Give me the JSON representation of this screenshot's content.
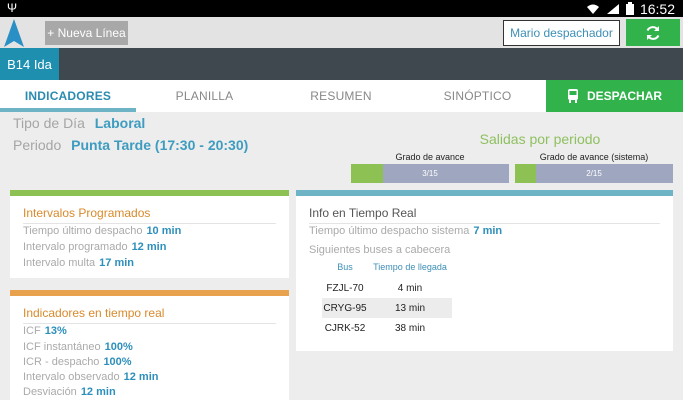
{
  "statusbar": {
    "time": "16:52"
  },
  "appbar": {
    "new_line_label": "+ Nueva Línea",
    "user_label": "Mario despachador"
  },
  "route": {
    "name": "B14 Ida"
  },
  "tabs": [
    {
      "label": "INDICADORES",
      "active": true
    },
    {
      "label": "PLANILLA"
    },
    {
      "label": "RESUMEN"
    },
    {
      "label": "SINÓPTICO"
    }
  ],
  "dispatch_label": "DESPACHAR",
  "info": {
    "tipo_label": "Tipo de Día",
    "tipo_value": "Laboral",
    "periodo_label": "Periodo",
    "periodo_value": "Punta Tarde (17:30 - 20:30)"
  },
  "salidas": {
    "title": "Salidas por periodo",
    "bars": [
      {
        "label": "Grado de avance",
        "text": "3/15",
        "fraction": 0.2
      },
      {
        "label": "Grado de avance (sistema)",
        "text": "2/15",
        "fraction": 0.133
      }
    ]
  },
  "intervalos": {
    "title": "Intervalos Programados",
    "rows": [
      {
        "label": "Tiempo último despacho",
        "value": "10 min"
      },
      {
        "label": "Intervalo programado",
        "value": "12 min"
      },
      {
        "label": "Intervalo multa",
        "value": "17 min"
      }
    ]
  },
  "tiempo_real": {
    "title": "Info en Tiempo Real",
    "rows": [
      {
        "label": "Tiempo último despacho sistema",
        "value": "7 min"
      }
    ],
    "subtitle": "Siguientes buses a cabecera",
    "headers": [
      "Bus",
      "Tiempo de llegada"
    ],
    "buses": [
      {
        "bus": "FZJL-70",
        "time": "4 min"
      },
      {
        "bus": "CRYG-95",
        "time": "13 min"
      },
      {
        "bus": "CJRK-52",
        "time": "38 min"
      }
    ]
  },
  "indicadores": {
    "title": "Indicadores en tiempo real",
    "rows": [
      {
        "label": "ICF",
        "value": "13%"
      },
      {
        "label": "ICF instantáneo",
        "value": "100%"
      },
      {
        "label": "ICR - despacho",
        "value": "100%"
      },
      {
        "label": "Intervalo observado",
        "value": "12 min"
      },
      {
        "label": "Desviación",
        "value": "12 min"
      }
    ]
  },
  "colors": {
    "accent_blue": "#1f8fb0",
    "green": "#31b24b",
    "panel_green": "#8dc153",
    "panel_orange": "#e8a14c",
    "panel_blue": "#6fb3c6"
  }
}
